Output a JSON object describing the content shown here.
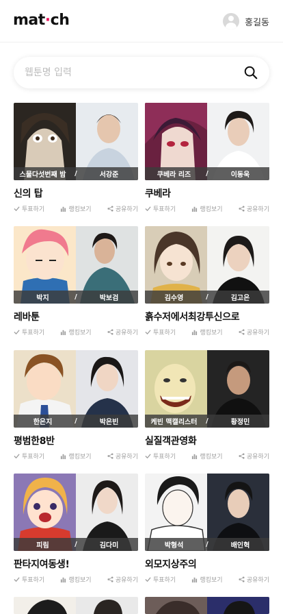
{
  "header": {
    "logo_left": "mat",
    "logo_dot": "·",
    "logo_right": "ch",
    "user_name": "홍길동"
  },
  "search": {
    "placeholder": "웹툰명 입력",
    "value": ""
  },
  "colors": {
    "accent": "#e8175d",
    "name_strip": "#3c3c3c",
    "action_text": "#9e9e9e"
  },
  "cards": [
    {
      "title": "신의 탑",
      "character": "스물다섯번째 밤",
      "actor": "서강준",
      "vote_label": "투표하기",
      "rank_label": "랭킹보기",
      "share_label": "공유하기"
    },
    {
      "title": "쿠베라",
      "character": "쿠베라 리즈",
      "actor": "이동욱",
      "vote_label": "투표하기",
      "rank_label": "랭킹보기",
      "share_label": "공유하기"
    },
    {
      "title": "레바툰",
      "character": "박지",
      "actor": "박보검",
      "vote_label": "투표하기",
      "rank_label": "랭킹보기",
      "share_label": "공유하기"
    },
    {
      "title": "흙수저에서최강투신으로",
      "character": "김수영",
      "actor": "김고은",
      "vote_label": "투표하기",
      "rank_label": "랭킹보기",
      "share_label": "공유하기"
    },
    {
      "title": "평범한8반",
      "character": "한은지",
      "actor": "박은빈",
      "vote_label": "투표하기",
      "rank_label": "랭킹보기",
      "share_label": "공유하기"
    },
    {
      "title": "실질객관영화",
      "character": "케빈 맥캘리스터",
      "actor": "황정민",
      "vote_label": "투표하기",
      "rank_label": "랭킹보기",
      "share_label": "공유하기"
    },
    {
      "title": "판타지여동생!",
      "character": "피림",
      "actor": "김다미",
      "vote_label": "투표하기",
      "rank_label": "랭킹보기",
      "share_label": "공유하기"
    },
    {
      "title": "외모지상주의",
      "character": "박형석",
      "actor": "배인혁",
      "vote_label": "투표하기",
      "rank_label": "랭킹보기",
      "share_label": "공유하기"
    }
  ]
}
